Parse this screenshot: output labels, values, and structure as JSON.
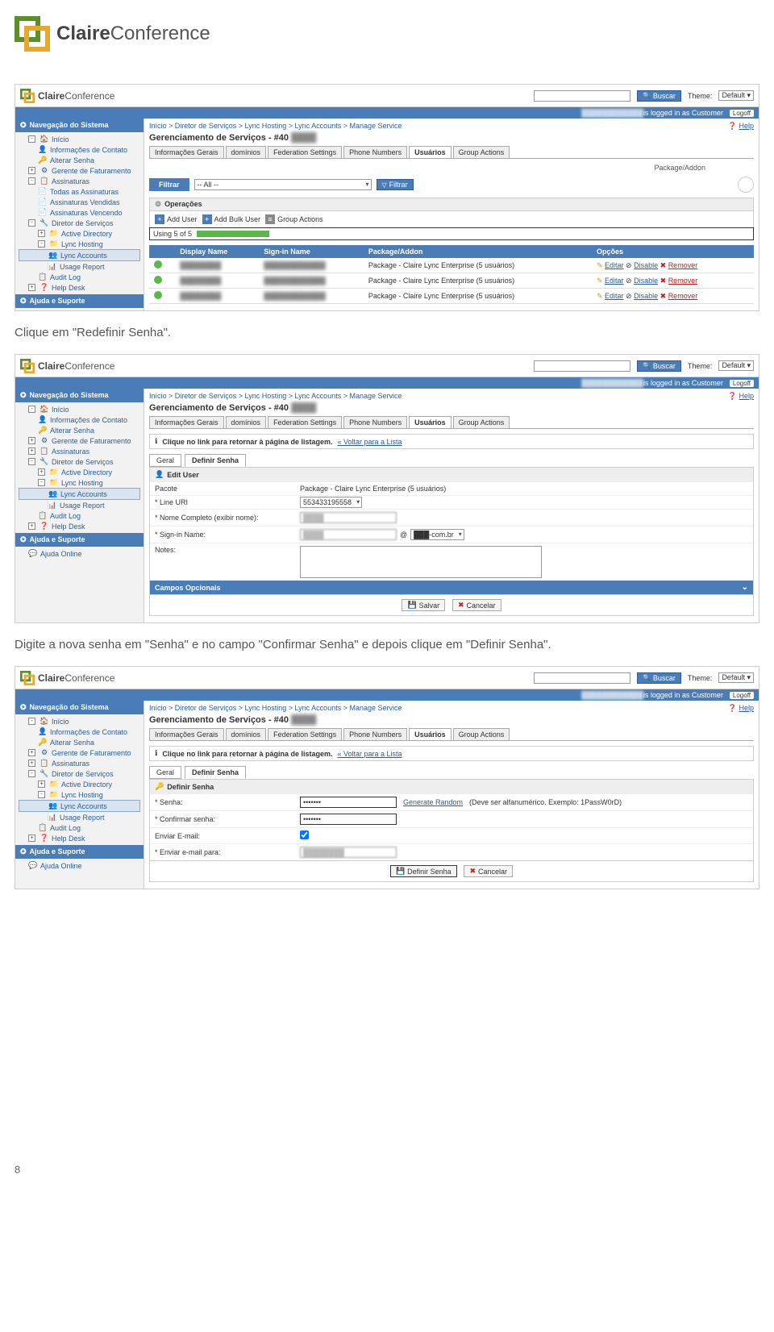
{
  "brand": {
    "name1": "Claire",
    "name2": "Conference"
  },
  "instructions": {
    "i1": "Clique em \"Redefinir Senha\".",
    "i2": "Digite a nova senha em \"Senha\" e no campo \"Confirmar Senha\" e depois clique em \"Definir Senha\"."
  },
  "pagenum": "8",
  "ss": {
    "search_btn": "Buscar",
    "theme_label": "Theme:",
    "theme_value": "Default",
    "userbar_text": "is logged in as Customer",
    "logoff": "Logoff",
    "help": "Help",
    "breadcrumb": "Início > Diretor de Serviços > Lync Hosting > Lync Accounts > Manage Service",
    "pagetitle": "Gerenciamento de Serviços - #40",
    "tabs": [
      "Informações Gerais",
      "domínios",
      "Federation Settings",
      "Phone Numbers",
      "Usuários",
      "Group Actions"
    ],
    "side_head1": "Navegação do Sistema",
    "side_head2": "Ajuda e Suporte",
    "sidebar_items": [
      {
        "lvl": 1,
        "exp": "-",
        "ico": "🏠",
        "label": "Início"
      },
      {
        "lvl": 2,
        "ico": "👤",
        "label": "Informações de Contato"
      },
      {
        "lvl": 2,
        "ico": "🔑",
        "label": "Alterar Senha"
      },
      {
        "lvl": 1,
        "exp": "+",
        "ico": "⚙",
        "label": "Gerente de Faturamento"
      },
      {
        "lvl": 1,
        "exp": "-",
        "ico": "📋",
        "label": "Assinaturas"
      },
      {
        "lvl": 2,
        "ico": "📄",
        "label": "Todas as Assinaturas"
      },
      {
        "lvl": 2,
        "ico": "📄",
        "label": "Assinaturas Vendidas"
      },
      {
        "lvl": 2,
        "ico": "📄",
        "label": "Assinaturas Vencendo"
      },
      {
        "lvl": 1,
        "exp": "-",
        "ico": "🔧",
        "label": "Diretor de Serviços"
      },
      {
        "lvl": 2,
        "exp": "+",
        "ico": "📁",
        "label": "Active Directory"
      },
      {
        "lvl": 2,
        "exp": "-",
        "ico": "📁",
        "label": "Lync Hosting"
      },
      {
        "lvl": 3,
        "ico": "👥",
        "label": "Lync Accounts",
        "sel": true
      },
      {
        "lvl": 3,
        "ico": "📊",
        "label": "Usage Report"
      },
      {
        "lvl": 2,
        "ico": "📋",
        "label": "Audit Log"
      },
      {
        "lvl": 1,
        "exp": "+",
        "ico": "❓",
        "label": "Help Desk"
      }
    ],
    "sidebar_items_b": [
      {
        "lvl": 1,
        "exp": "-",
        "ico": "🏠",
        "label": "Início"
      },
      {
        "lvl": 2,
        "ico": "👤",
        "label": "Informações de Contato"
      },
      {
        "lvl": 2,
        "ico": "🔑",
        "label": "Alterar Senha"
      },
      {
        "lvl": 1,
        "exp": "+",
        "ico": "⚙",
        "label": "Gerente de Faturamento"
      },
      {
        "lvl": 1,
        "exp": "+",
        "ico": "📋",
        "label": "Assinaturas"
      },
      {
        "lvl": 1,
        "exp": "-",
        "ico": "🔧",
        "label": "Diretor de Serviços"
      },
      {
        "lvl": 2,
        "exp": "+",
        "ico": "📁",
        "label": "Active Directory"
      },
      {
        "lvl": 2,
        "exp": "-",
        "ico": "📁",
        "label": "Lync Hosting"
      },
      {
        "lvl": 3,
        "ico": "👥",
        "label": "Lync Accounts",
        "sel": true
      },
      {
        "lvl": 3,
        "ico": "📊",
        "label": "Usage Report"
      },
      {
        "lvl": 2,
        "ico": "📋",
        "label": "Audit Log"
      },
      {
        "lvl": 1,
        "exp": "+",
        "ico": "❓",
        "label": "Help Desk"
      }
    ],
    "ajuda_item": "Ajuda Online"
  },
  "ss1": {
    "filtrar": "Filtrar",
    "filtrar_val": "-- All --",
    "filtrar2": "Filtrar",
    "pkg_label": "Package/Addon",
    "operacoes": "Operações",
    "add_user": "Add User",
    "add_bulk": "Add Bulk User",
    "group_act": "Group Actions",
    "using": "Using 5 of 5",
    "th": [
      "",
      "Display Name",
      "Sign-in Name",
      "Package/Addon",
      "Opções"
    ],
    "pkg_val": "Package - Claire Lync Enterprise (5 usuários)",
    "ops": {
      "editar": "Editar",
      "disable": "Disable",
      "remover": "Remover"
    }
  },
  "ss2": {
    "info_text": "Clique no link para retornar à página de listagem.",
    "info_link": "« Voltar para a Lista",
    "subtabs": [
      "Geral",
      "Definir Senha"
    ],
    "edit_head": "Edit User",
    "pacote_lbl": "Pacote",
    "pacote_val": "Package - Claire Lync Enterprise (5 usuários)",
    "lineuri_lbl": "* Line URI",
    "lineuri_val": "553433195558",
    "nome_lbl": "* Nome Completo (exibir nome):",
    "sign_lbl": "* Sign-in Name:",
    "sign_suffix": "-com.br",
    "notes_lbl": "Notes:",
    "opcionais": "Campos Opcionais",
    "salvar": "Salvar",
    "cancelar": "Cancelar"
  },
  "ss3": {
    "info_text": "Clique no link para retornar à página de listagem.",
    "info_link": "« Voltar para a Lista",
    "subtabs": [
      "Geral",
      "Definir Senha"
    ],
    "head": "Definir Senha",
    "senha_lbl": "* Senha:",
    "conf_lbl": "* Confirmar senha:",
    "gen_link": "Generate Random",
    "hint": "(Deve ser alfanumérico. Exemplo: 1PassW0rD)",
    "enviar_email_lbl": "Enviar E-mail:",
    "enviar_para_lbl": "* Enviar e-mail para:",
    "definir_btn": "Definir Senha",
    "cancelar": "Cancelar",
    "dots": "•••••••"
  }
}
